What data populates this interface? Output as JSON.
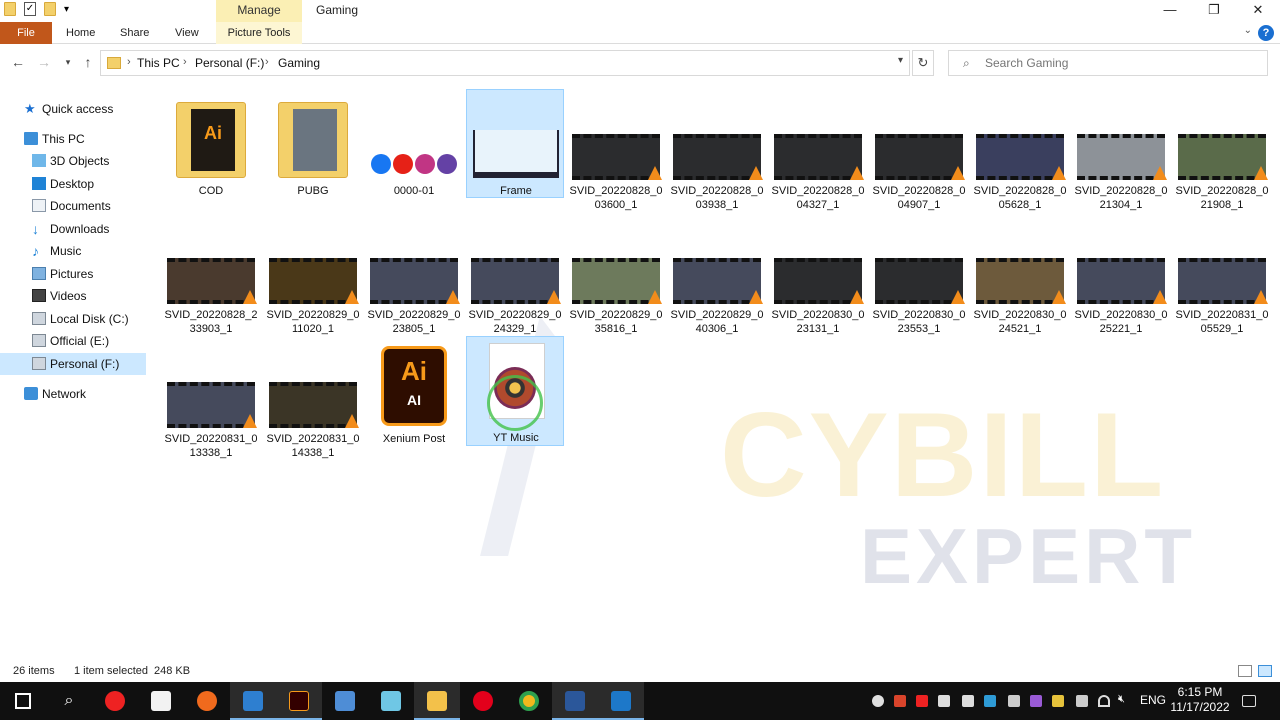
{
  "window": {
    "title": "Gaming",
    "manage_label": "Manage",
    "minimize": "—",
    "maximize": "❐",
    "close": "✕"
  },
  "ribbon": {
    "tabs": [
      "File",
      "Home",
      "Share",
      "View",
      "Picture Tools"
    ],
    "help": "?",
    "expand": "⌄"
  },
  "address": {
    "crumbs": [
      "This PC",
      "Personal (F:)",
      "Gaming"
    ],
    "search_placeholder": "Search Gaming"
  },
  "sidebar": {
    "items": [
      {
        "label": "Quick access",
        "icon": "star-icon"
      },
      {
        "label": "This PC",
        "icon": "computer-icon"
      },
      {
        "label": "3D Objects",
        "icon": "cube-icon"
      },
      {
        "label": "Desktop",
        "icon": "desktop-icon"
      },
      {
        "label": "Documents",
        "icon": "document-icon"
      },
      {
        "label": "Downloads",
        "icon": "download-icon"
      },
      {
        "label": "Music",
        "icon": "music-icon"
      },
      {
        "label": "Pictures",
        "icon": "pictures-icon"
      },
      {
        "label": "Videos",
        "icon": "videos-icon"
      },
      {
        "label": "Local Disk (C:)",
        "icon": "drive-icon"
      },
      {
        "label": "Official (E:)",
        "icon": "drive-icon"
      },
      {
        "label": "Personal (F:)",
        "icon": "drive-icon"
      },
      {
        "label": "Network",
        "icon": "network-icon"
      }
    ]
  },
  "files": [
    {
      "name": "COD",
      "kind": "folder-ai"
    },
    {
      "name": "PUBG",
      "kind": "folder-pubg"
    },
    {
      "name": "0000-01",
      "kind": "social"
    },
    {
      "name": "Frame",
      "kind": "frame"
    },
    {
      "name": "SVID_20220828_003600_1",
      "kind": "video"
    },
    {
      "name": "SVID_20220828_003938_1",
      "kind": "video"
    },
    {
      "name": "SVID_20220828_004327_1",
      "kind": "video"
    },
    {
      "name": "SVID_20220828_004907_1",
      "kind": "video"
    },
    {
      "name": "SVID_20220828_005628_1",
      "kind": "video"
    },
    {
      "name": "SVID_20220828_021304_1",
      "kind": "video"
    },
    {
      "name": "SVID_20220828_021908_1",
      "kind": "video"
    },
    {
      "name": "SVID_20220828_233903_1",
      "kind": "video"
    },
    {
      "name": "SVID_20220829_011020_1",
      "kind": "video"
    },
    {
      "name": "SVID_20220829_023805_1",
      "kind": "video"
    },
    {
      "name": "SVID_20220829_024329_1",
      "kind": "video"
    },
    {
      "name": "SVID_20220829_035816_1",
      "kind": "video"
    },
    {
      "name": "SVID_20220829_040306_1",
      "kind": "video"
    },
    {
      "name": "SVID_20220830_023131_1",
      "kind": "video"
    },
    {
      "name": "SVID_20220830_023553_1",
      "kind": "video"
    },
    {
      "name": "SVID_20220830_024521_1",
      "kind": "video"
    },
    {
      "name": "SVID_20220830_025221_1",
      "kind": "video"
    },
    {
      "name": "SVID_20220831_005529_1",
      "kind": "video"
    },
    {
      "name": "SVID_20220831_013338_1",
      "kind": "video"
    },
    {
      "name": "SVID_20220831_014338_1",
      "kind": "video"
    },
    {
      "name": "Xenium Post",
      "kind": "ai"
    },
    {
      "name": "YT Music",
      "kind": "music"
    }
  ],
  "watermark": {
    "line1": "CYBILL",
    "line2": "EXPERT"
  },
  "status": {
    "count": "26 items",
    "selection": "1 item selected",
    "size": "248 KB"
  },
  "taskbar": {
    "language": "ENG",
    "time": "6:15 PM",
    "date": "11/17/2022"
  },
  "colors": {
    "file_tab": "#c1571b",
    "selection": "#cce8ff",
    "taskbar": "#101010",
    "accent": "#1a6fd1"
  }
}
